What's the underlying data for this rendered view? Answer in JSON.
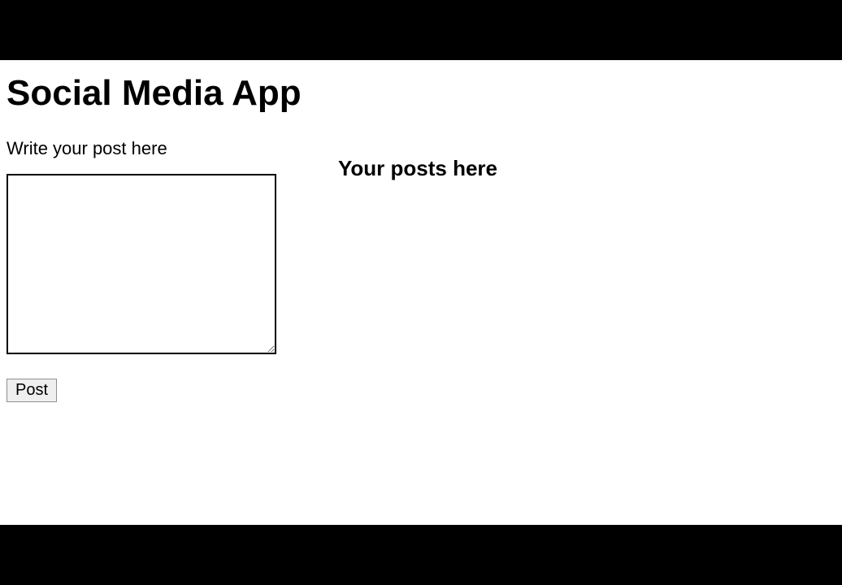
{
  "header": {
    "title": "Social Media App"
  },
  "compose": {
    "prompt": "Write your post here",
    "textarea_value": "",
    "post_button_label": "Post"
  },
  "feed": {
    "heading": "Your posts here"
  }
}
